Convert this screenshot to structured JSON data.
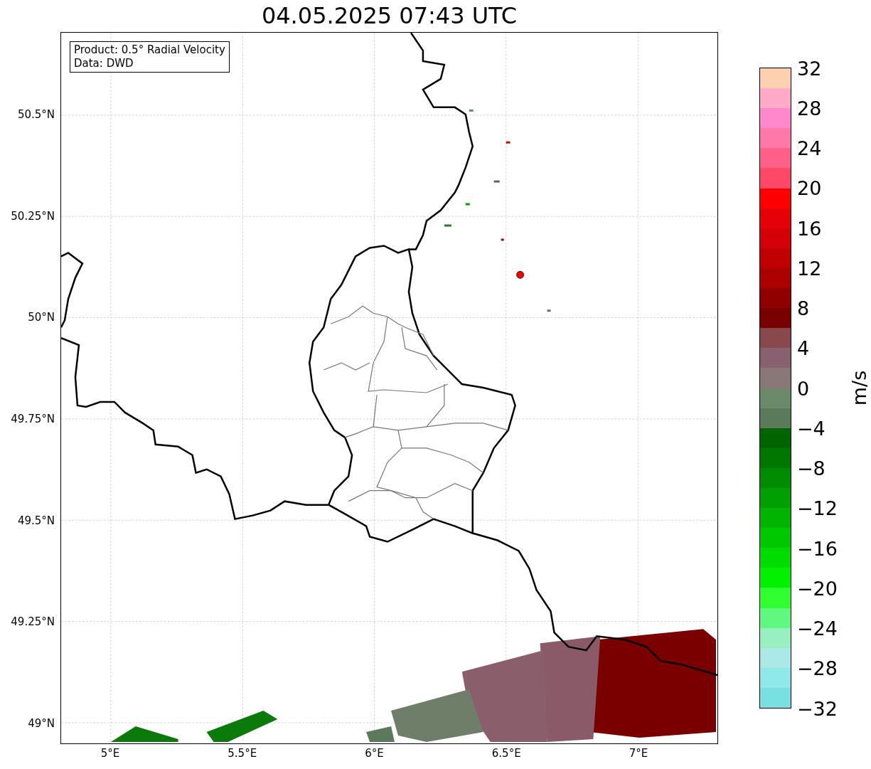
{
  "title": "04.05.2025 07:43 UTC",
  "legend": [
    "Product: 0.5° Radial Velocity",
    "Data: DWD"
  ],
  "map": {
    "y_ticks": [
      "50.5°N",
      "50.25°N",
      "50°N",
      "49.75°N",
      "49.5°N",
      "49.25°N",
      "49°N"
    ],
    "x_ticks": [
      "5°E",
      "5.5°E",
      "6°E",
      "6.5°E",
      "7°E"
    ]
  },
  "colorbar": {
    "label": "m/s",
    "ticks": [
      "32",
      "28",
      "24",
      "20",
      "16",
      "12",
      "8",
      "4",
      "0",
      "−4",
      "−8",
      "−12",
      "−16",
      "−20",
      "−24",
      "−28",
      "−32"
    ],
    "bands": [
      {
        "color": "#ffd0b0"
      },
      {
        "color": "#ffaac8"
      },
      {
        "color": "#ff88cc"
      },
      {
        "color": "#ff78a8"
      },
      {
        "color": "#ff6088"
      },
      {
        "color": "#ff4868"
      },
      {
        "color": "#ff0000"
      },
      {
        "color": "#e60008"
      },
      {
        "color": "#d40008"
      },
      {
        "color": "#c00000"
      },
      {
        "color": "#aa0000"
      },
      {
        "color": "#900000"
      },
      {
        "color": "#780000"
      },
      {
        "color": "#88484e"
      },
      {
        "color": "#886070"
      },
      {
        "color": "#8a7878"
      },
      {
        "color": "#6a8a6a"
      },
      {
        "color": "#5a7a5a"
      },
      {
        "color": "#006400"
      },
      {
        "color": "#007800"
      },
      {
        "color": "#008c00"
      },
      {
        "color": "#00a000"
      },
      {
        "color": "#00b400"
      },
      {
        "color": "#00c800"
      },
      {
        "color": "#00dc00"
      },
      {
        "color": "#00f000"
      },
      {
        "color": "#30ff30"
      },
      {
        "color": "#60f880"
      },
      {
        "color": "#98f0c0"
      },
      {
        "color": "#aae8e8"
      },
      {
        "color": "#90e8e8"
      },
      {
        "color": "#78e0e0"
      }
    ]
  }
}
